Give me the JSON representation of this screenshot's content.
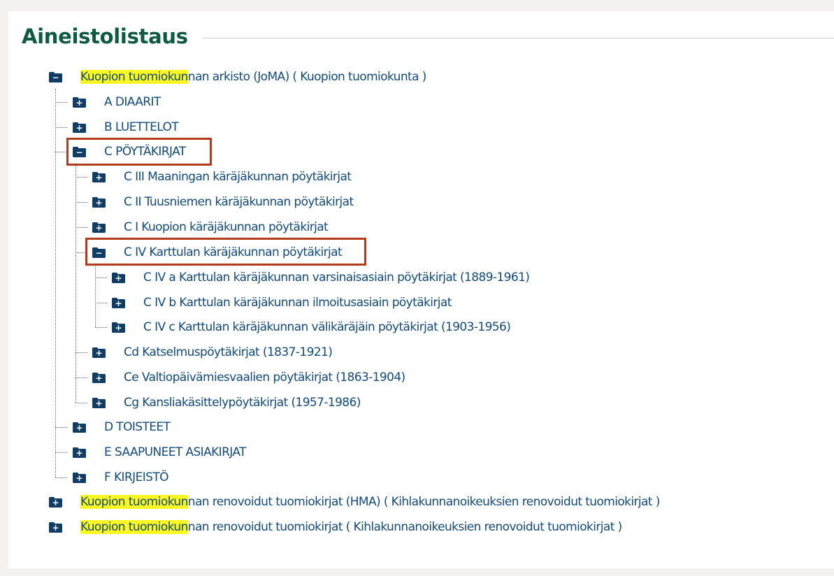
{
  "heading": "Aineistolistaus",
  "tree": {
    "root1": {
      "highlight": "Kuopion tuomiokun",
      "rest": "nan arkisto (JoMA) ( Kuopion tuomiokunta )",
      "expanded": true
    },
    "a": "A DIAARIT",
    "b": "B LUETTELOT",
    "c": "C PÖYTÄKIRJAT",
    "c3": "C III Maaningan käräjäkunnan pöytäkirjat",
    "c2": "C II Tuusniemen käräjäkunnan pöytäkirjat",
    "c1": "C I Kuopion käräjäkunnan pöytäkirjat",
    "c4": "C IV Karttulan käräjäkunnan pöytäkirjat",
    "c4a": "C IV a Karttulan käräjäkunnan varsinaisasiain pöytäkirjat (1889-1961)",
    "c4b": "C IV b Karttulan käräjäkunnan ilmoitusasiain pöytäkirjat",
    "c4c": "C IV c Karttulan käräjäkunnan välikäräjäin pöytäkirjat (1903-1956)",
    "cd": "Cd Katselmuspöytäkirjat (1837-1921)",
    "ce": "Ce Valtiopäivämiesvaalien pöytäkirjat (1863-1904)",
    "cg": "Cg Kansliakäsittelypöytäkirjat (1957-1986)",
    "d": "D TOISTEET",
    "e": "E SAAPUNEET ASIAKIRJAT",
    "f": "F KIRJEISTÖ",
    "root2": {
      "highlight": "Kuopion tuomiokun",
      "rest": "nan renovoidut tuomiokirjat (HMA) ( Kihlakunnanoikeuksien renovoidut tuomiokirjat )"
    },
    "root3": {
      "highlight": "Kuopion tuomiokun",
      "rest": "nan renovoidut tuomiokirjat ( Kihlakunnanoikeuksien renovoidut tuomiokirjat )"
    }
  },
  "icons": {
    "expanded": "−",
    "collapsed": "+"
  },
  "colors": {
    "heading": "#0f5a43",
    "link": "#124a7a",
    "folder": "#0f3d66",
    "highlight": "#fbf722",
    "annotation_box": "#b23a1d"
  }
}
